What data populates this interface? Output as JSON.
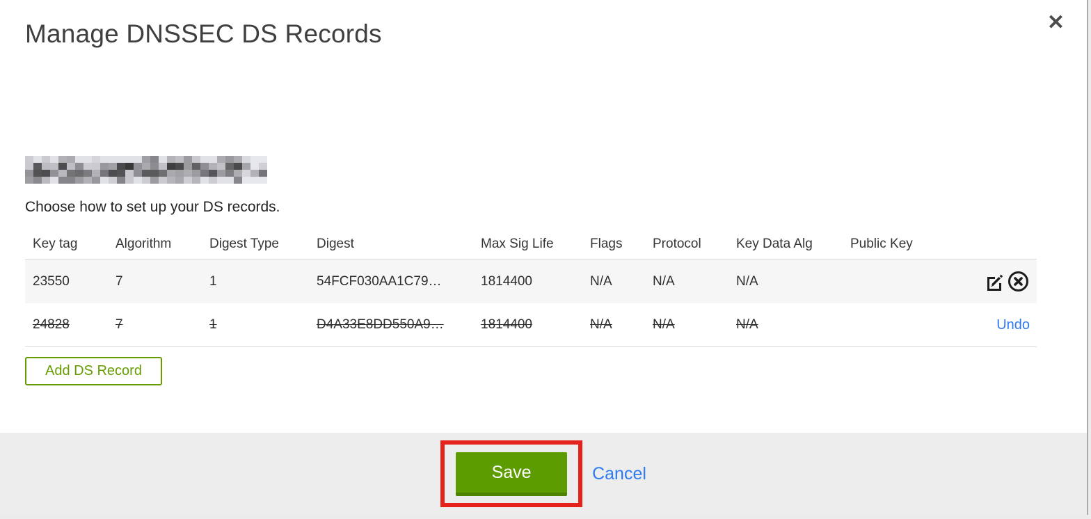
{
  "dialog": {
    "title": "Manage DNSSEC DS Records",
    "instruction": "Choose how to set up your DS records.",
    "domain_redacted": true
  },
  "icons": {
    "close": "✕",
    "edit": "edit-pencil-square",
    "delete": "circle-x"
  },
  "table": {
    "columns": [
      "Key tag",
      "Algorithm",
      "Digest Type",
      "Digest",
      "Max Sig Life",
      "Flags",
      "Protocol",
      "Key Data Alg",
      "Public Key"
    ],
    "rows": [
      {
        "key_tag": "23550",
        "algorithm": "7",
        "digest_type": "1",
        "digest": "54FCF030AA1C79…",
        "max_sig_life": "1814400",
        "flags": "N/A",
        "protocol": "N/A",
        "key_data_alg": "N/A",
        "public_key": "",
        "state": "active"
      },
      {
        "key_tag": "24828",
        "algorithm": "7",
        "digest_type": "1",
        "digest": "D4A33E8DD550A9…",
        "max_sig_life": "1814400",
        "flags": "N/A",
        "protocol": "N/A",
        "key_data_alg": "N/A",
        "public_key": "",
        "state": "marked-for-deletion",
        "undo_label": "Undo"
      }
    ]
  },
  "buttons": {
    "add_ds_record": "Add DS Record",
    "save": "Save",
    "cancel": "Cancel"
  },
  "colors": {
    "primary_green": "#5d9c00",
    "outline_green": "#669c00",
    "link_blue": "#2f7bf2",
    "annotation_red": "#e4231c",
    "footer_bg": "#ededed",
    "row_stripe": "#f6f6f6"
  }
}
